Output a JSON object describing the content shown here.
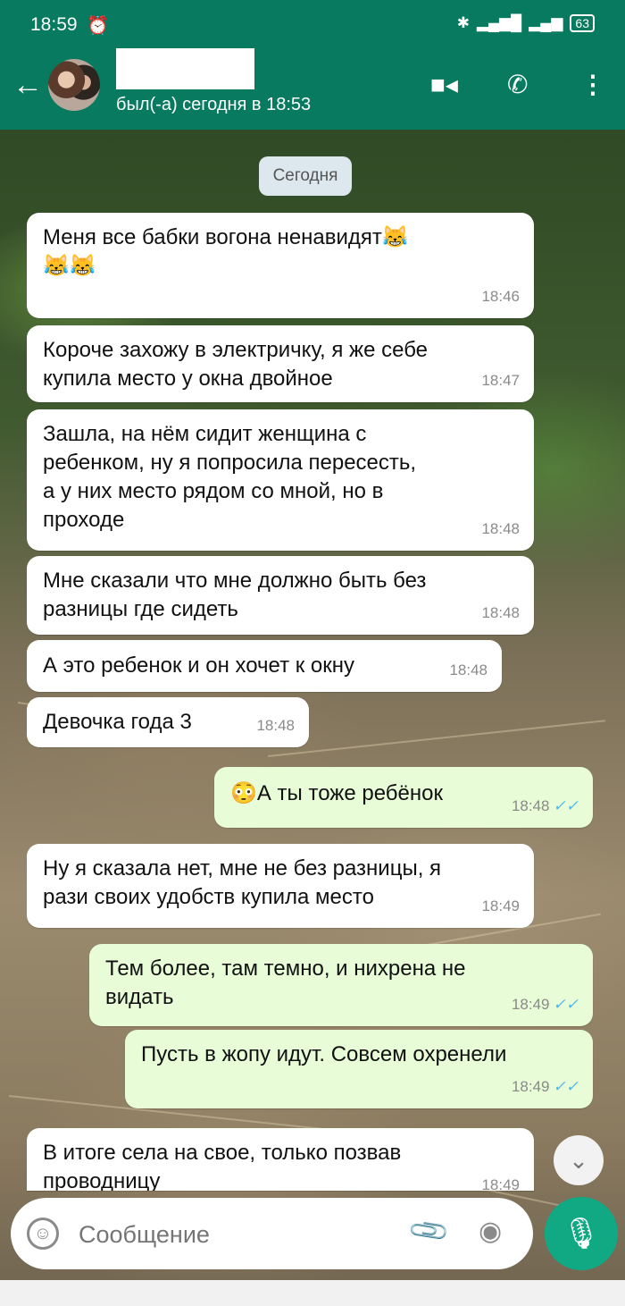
{
  "status_bar": {
    "time": "18:59",
    "battery": "63"
  },
  "chat_header": {
    "last_seen": "был(-а) сегодня в 18:53"
  },
  "date_chip": "Сегодня",
  "messages": [
    {
      "text": "Меня все бабки вогона ненавидят😹\n😹😹",
      "time": "18:46",
      "direction": "in"
    },
    {
      "text": "Короче захожу в электричку, я же себе\nкупила место у окна двойное",
      "time": "18:47",
      "direction": "in"
    },
    {
      "text": "Зашла, на нём сидит женщина с\nребенком, ну я попросила пересесть,\nа у них место рядом со мной, но в\nпроходе",
      "time": "18:48",
      "direction": "in"
    },
    {
      "text": "Мне сказали что мне должно быть без\nразницы где сидеть",
      "time": "18:48",
      "direction": "in"
    },
    {
      "text": "А это ребенок и он хочет к окну",
      "time": "18:48",
      "direction": "in"
    },
    {
      "text": "Девочка года 3",
      "time": "18:48",
      "direction": "in"
    },
    {
      "text": "😳А ты тоже ребёнок",
      "time": "18:48",
      "direction": "out"
    },
    {
      "text": "Ну я сказала нет, мне не без разницы, я\nрази своих удобств купила место",
      "time": "18:49",
      "direction": "in"
    },
    {
      "text": "Тем более, там темно, и нихрена не\nвидать",
      "time": "18:49",
      "direction": "out"
    },
    {
      "text": "Пусть в жопу идут. Совсем охренели",
      "time": "18:49",
      "direction": "out"
    },
    {
      "text": "В итоге села на свое, только позвав\nпроводницу",
      "time": "18:49",
      "direction": "in"
    }
  ],
  "input": {
    "placeholder": "Сообщение"
  },
  "icons": {
    "back": "arrow-left-icon",
    "video": "video-call-icon",
    "call": "phone-icon",
    "menu": "more-vert-icon",
    "emoji": "emoji-icon",
    "attach": "paperclip-icon",
    "camera": "camera-icon",
    "mic": "microphone-icon",
    "scroll": "chevron-double-down-icon"
  },
  "colors": {
    "header": "#087a5f",
    "incoming": "#ffffff",
    "outgoing": "#e7fcd7",
    "mic": "#11a884",
    "read_tick": "#4fb6ec"
  }
}
